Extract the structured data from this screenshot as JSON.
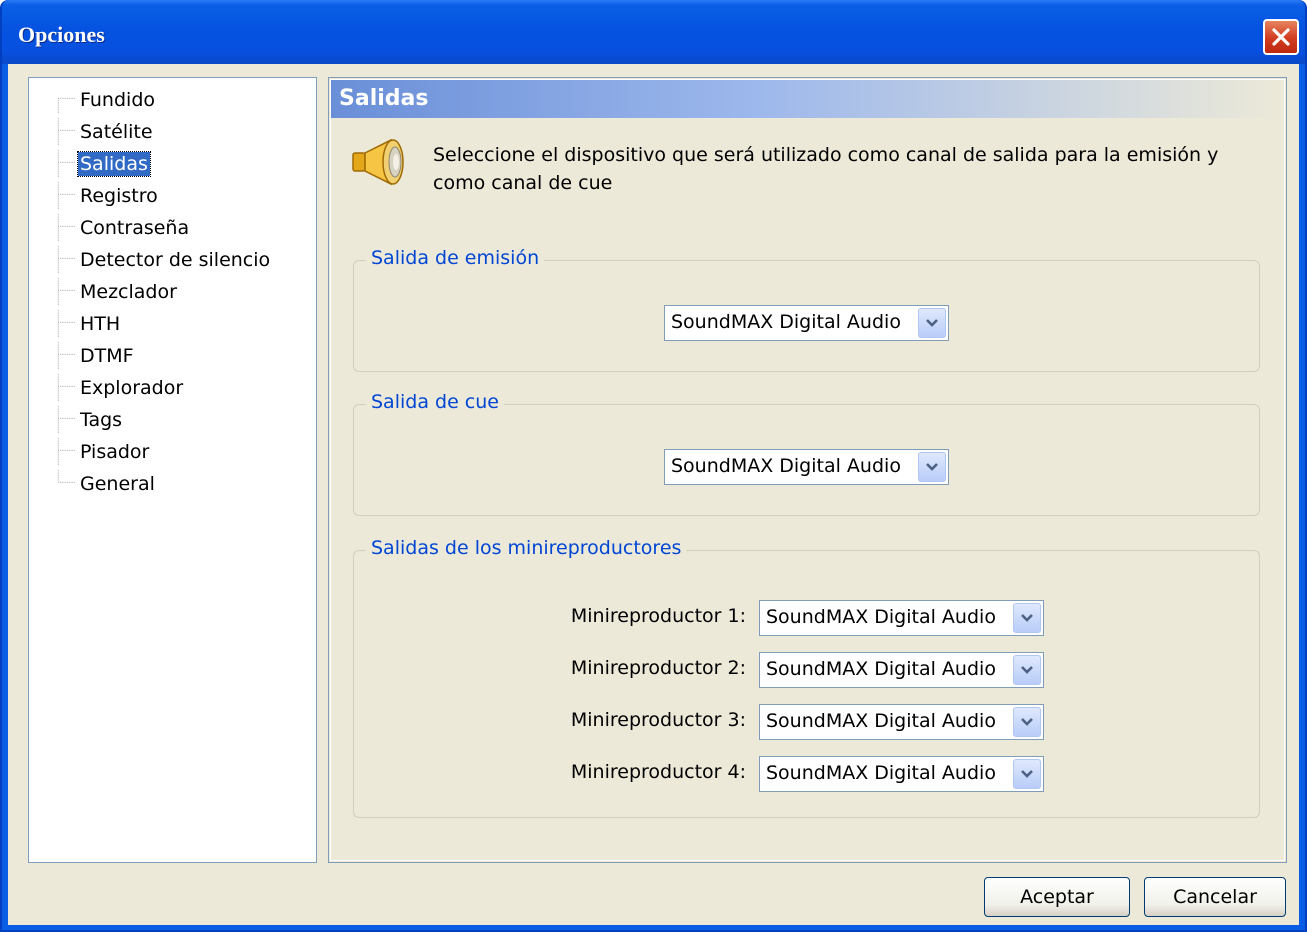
{
  "window": {
    "title": "Opciones"
  },
  "tree": {
    "items": [
      {
        "label": "Fundido",
        "selected": false
      },
      {
        "label": "Satélite",
        "selected": false
      },
      {
        "label": "Salidas",
        "selected": true
      },
      {
        "label": "Registro",
        "selected": false
      },
      {
        "label": "Contraseña",
        "selected": false
      },
      {
        "label": "Detector de silencio",
        "selected": false
      },
      {
        "label": "Mezclador",
        "selected": false
      },
      {
        "label": "HTH",
        "selected": false
      },
      {
        "label": "DTMF",
        "selected": false
      },
      {
        "label": "Explorador",
        "selected": false
      },
      {
        "label": "Tags",
        "selected": false
      },
      {
        "label": "Pisador",
        "selected": false
      },
      {
        "label": "General",
        "selected": false
      }
    ]
  },
  "panel": {
    "title": "Salidas",
    "icon": "speaker-icon",
    "description": "Seleccione el dispositivo que será utilizado como canal de salida para la emisión y como canal de cue"
  },
  "groups": {
    "emision": {
      "label": "Salida de emisión",
      "value": "SoundMAX Digital Audio"
    },
    "cue": {
      "label": "Salida de cue",
      "value": "SoundMAX Digital Audio"
    },
    "mini": {
      "label": "Salidas de los minireproductores",
      "items": [
        {
          "label": "Minireproductor 1:",
          "value": "SoundMAX Digital Audio"
        },
        {
          "label": "Minireproductor 2:",
          "value": "SoundMAX Digital Audio"
        },
        {
          "label": "Minireproductor 3:",
          "value": "SoundMAX Digital Audio"
        },
        {
          "label": "Minireproductor 4:",
          "value": "SoundMAX Digital Audio"
        }
      ]
    }
  },
  "buttons": {
    "accept": "Aceptar",
    "cancel": "Cancelar"
  },
  "colors": {
    "titlebar": "#0a5ee6",
    "selection": "#316ac5",
    "group_label": "#0046d5",
    "face": "#ece9d8"
  }
}
